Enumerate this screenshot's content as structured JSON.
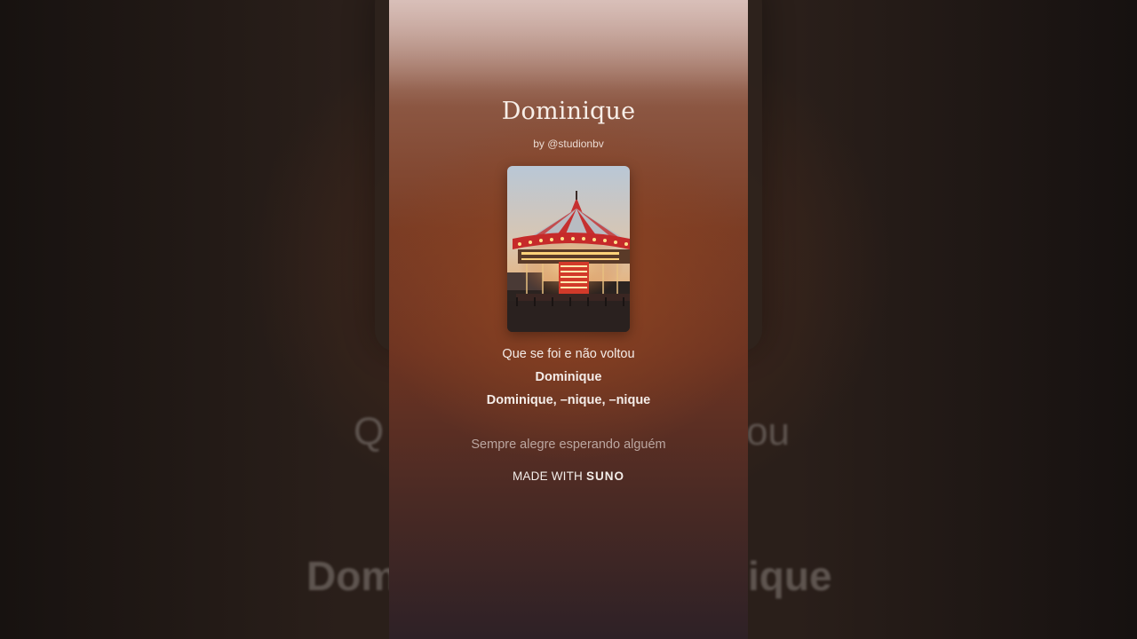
{
  "song": {
    "title": "Dominique",
    "byline": "by @studionbv",
    "cover_icon": "carousel-artwork"
  },
  "lyrics": {
    "previous_line": "Que se foi e não voltou",
    "current_line_1": "Dominique",
    "current_line_2": "Dominique, –nique, –nique",
    "next_line": "Sempre alegre esperando alguém"
  },
  "footer": {
    "made_with": "MADE WITH",
    "brand": "SUNO"
  },
  "background": {
    "left_1": "Q",
    "right_1": "ou",
    "left_2": "Dom",
    "right_2": "ique"
  },
  "colors": {
    "accent": "#8e4422",
    "panel_bottom": "#2e2126",
    "text": "#f4ece8"
  }
}
